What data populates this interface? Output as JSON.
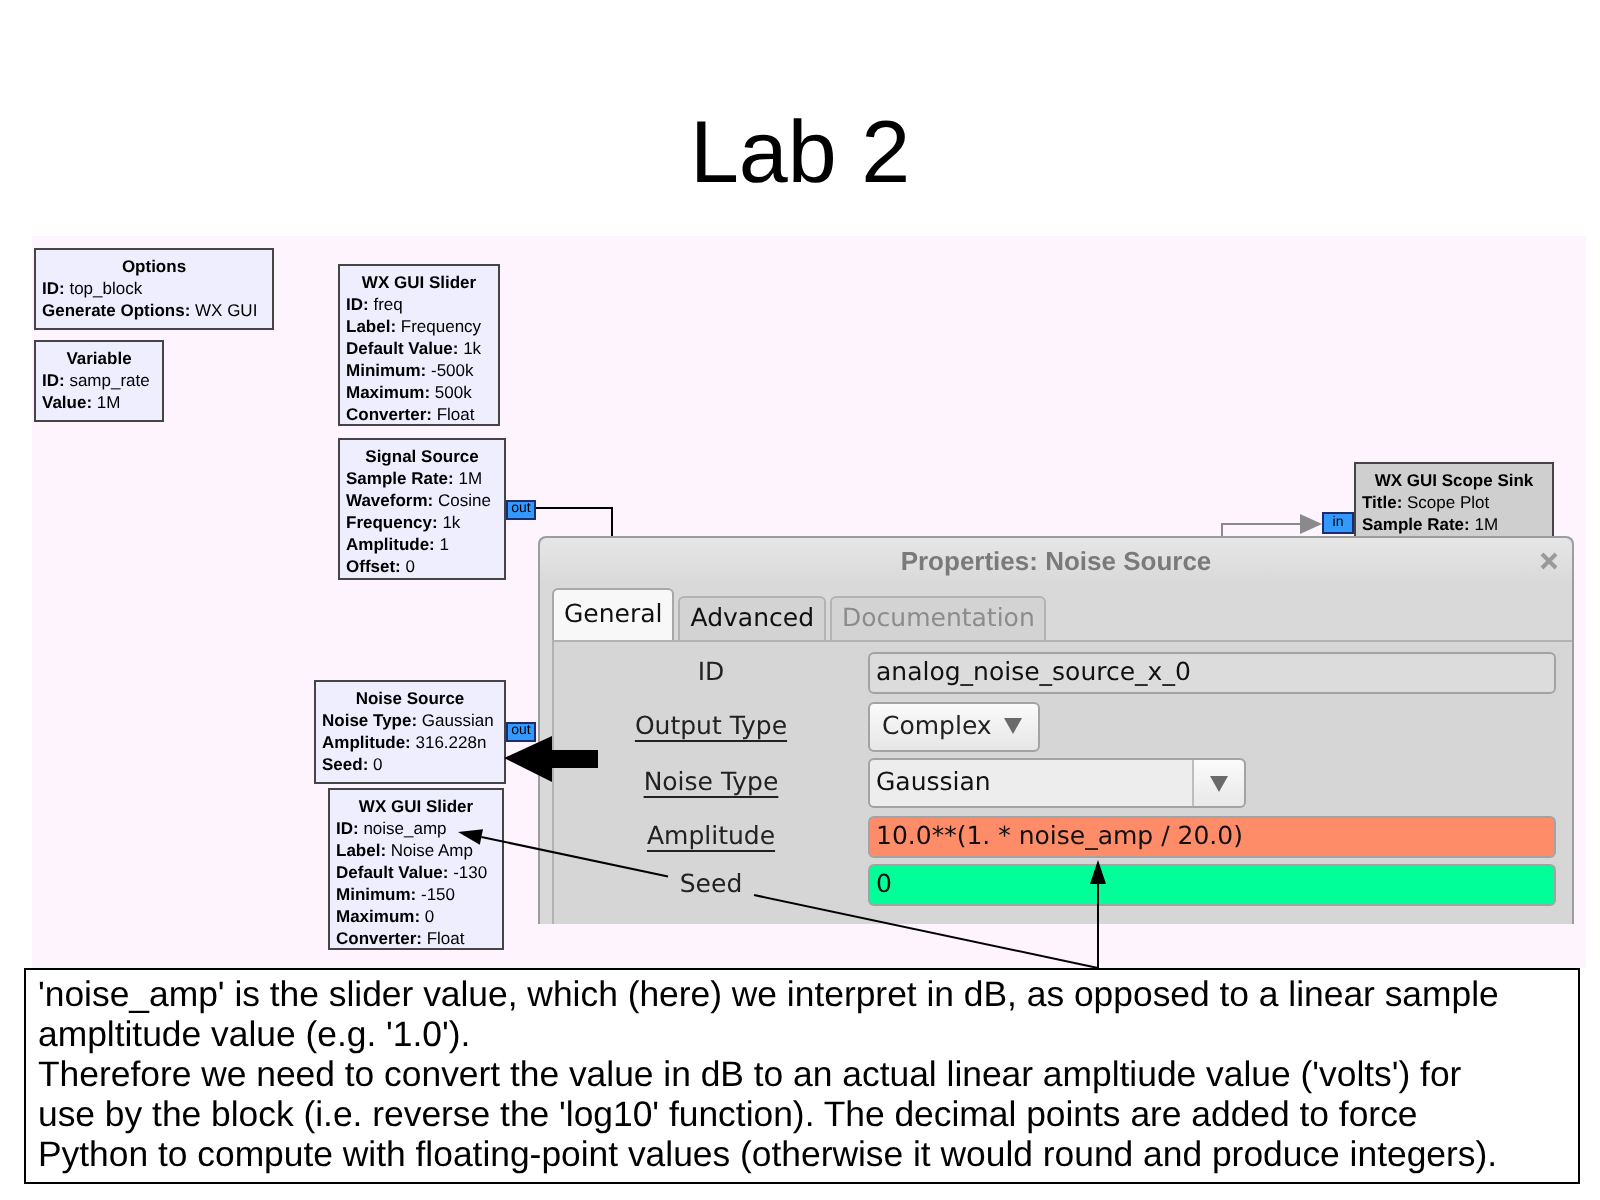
{
  "slide": {
    "title": "Lab 2"
  },
  "canvas": {
    "blocks": [
      {
        "title": "Options",
        "color": "#eeeeff",
        "params": [
          "**ID:** top_block",
          "**Generate Options:** WX GUI"
        ]
      },
      {
        "title": "Variable",
        "color": "#eeeeff",
        "params": [
          "**ID:** samp_rate",
          "**Value:** 1M"
        ]
      },
      {
        "title": "WX GUI Slider",
        "color": "#eeeeff",
        "params": [
          "**ID:** freq",
          "**Label:** Frequency",
          "**Default Value:** 1k",
          "**Minimum:** -500k",
          "**Maximum:** 500k",
          "**Converter:** Float"
        ]
      },
      {
        "title": "Signal Source",
        "color": "#eeeeff",
        "params": [
          "**Sample Rate:** 1M",
          "**Waveform:** Cosine",
          "**Frequency:** 1k",
          "**Amplitude:** 1",
          "**Offset:** 0"
        ],
        "ports": [
          {
            "kind": "output",
            "label": "out"
          }
        ]
      },
      {
        "title": "Noise Source",
        "color": "#eeeeff",
        "params": [
          "**Noise Type:** Gaussian",
          "**Amplitude:** 316.228n",
          "**Seed:** 0"
        ],
        "ports": [
          {
            "kind": "output",
            "label": "out"
          }
        ]
      },
      {
        "title": "WX GUI Slider",
        "color": "#eeeeff",
        "params": [
          "**ID:** noise_amp",
          "**Label:** Noise Amp",
          "**Default Value:** -130",
          "**Minimum:** -150",
          "**Maximum:** 0",
          "**Converter:** Float"
        ]
      },
      {
        "title": "WX GUI Scope Sink",
        "color": "#cfcfcf",
        "params": [
          "**Title:** Scope Plot",
          "**Sample Rate:** 1M"
        ],
        "ports": [
          {
            "kind": "input",
            "label": "in"
          }
        ]
      }
    ]
  },
  "dialog": {
    "title": "Properties: Noise Source",
    "tabs": [
      {
        "label": "General",
        "selected": true,
        "disabled": false
      },
      {
        "label": "Advanced",
        "selected": false,
        "disabled": false
      },
      {
        "label": "Documentation",
        "selected": false,
        "disabled": true
      }
    ],
    "fields": [
      {
        "label": "ID",
        "underlined": false,
        "kind": "entry",
        "value": "analog_noise_source_x_0",
        "color": "#dcdcdc"
      },
      {
        "label": "Output Type",
        "underlined": true,
        "kind": "dropdown",
        "value": "Complex"
      },
      {
        "label": "Noise Type",
        "underlined": true,
        "kind": "combo",
        "value": "Gaussian"
      },
      {
        "label": "Amplitude",
        "underlined": true,
        "kind": "entry",
        "value": "10.0**(1. * noise_amp / 20.0)",
        "color": "#ff8c69"
      },
      {
        "label": "Seed",
        "underlined": false,
        "kind": "entry",
        "value": "0",
        "color": "#00ff99"
      }
    ]
  },
  "note": {
    "paragraphs": [
      "'noise_amp' is the slider value, which (here) we interpret in dB, as opposed to a linear sample ampltitude value (e.g. '1.0').",
      "Therefore we need to convert the value in dB to an actual linear ampltiude value ('volts') for use by the block (i.e. reverse the 'log10' function). The decimal points are added to force Python to compute with floating-point values (otherwise it would round and produce integers)."
    ]
  }
}
